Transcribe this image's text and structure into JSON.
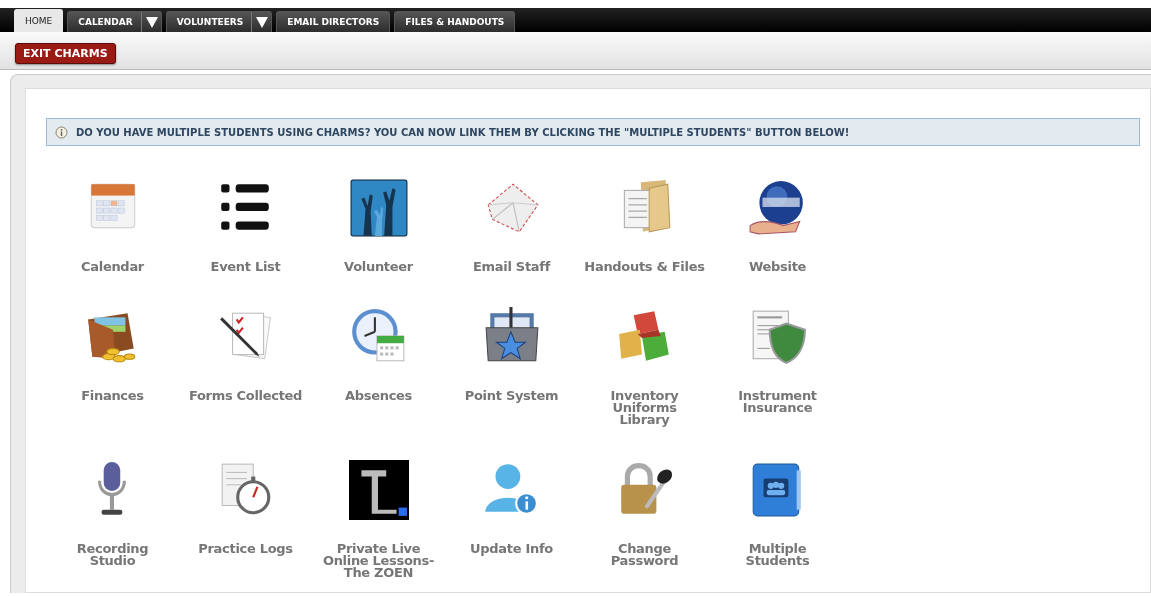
{
  "tabs": [
    {
      "label": "HOME",
      "selected": true,
      "dropdown": false
    },
    {
      "label": "CALENDAR",
      "selected": false,
      "dropdown": true
    },
    {
      "label": "VOLUNTEERS",
      "selected": false,
      "dropdown": true
    },
    {
      "label": "EMAIL DIRECTORS",
      "selected": false,
      "dropdown": false
    },
    {
      "label": "FILES & HANDOUTS",
      "selected": false,
      "dropdown": false
    }
  ],
  "toolbar": {
    "exit_button": "EXIT CHARMS"
  },
  "notice": {
    "message": "DO YOU HAVE MULTIPLE STUDENTS USING CHARMS? YOU CAN NOW LINK THEM BY CLICKING THE \"MULTIPLE STUDENTS\" BUTTON BELOW!"
  },
  "tiles": [
    {
      "label": "Calendar"
    },
    {
      "label": "Event List"
    },
    {
      "label": "Volunteer"
    },
    {
      "label": "Email Staff"
    },
    {
      "label": "Handouts & Files"
    },
    {
      "label": "Website"
    },
    {
      "label": "Finances"
    },
    {
      "label": "Forms Collected"
    },
    {
      "label": "Absences"
    },
    {
      "label": "Point System"
    },
    {
      "label": "Inventory\nUniforms\nLibrary"
    },
    {
      "label": "Instrument\nInsurance"
    },
    {
      "label": "Recording\nStudio"
    },
    {
      "label": "Practice Logs"
    },
    {
      "label": "Private Live\nOnline Lessons-\nThe ZOEN"
    },
    {
      "label": "Update Info"
    },
    {
      "label": "Change\nPassword"
    },
    {
      "label": "Multiple\nStudents"
    }
  ]
}
